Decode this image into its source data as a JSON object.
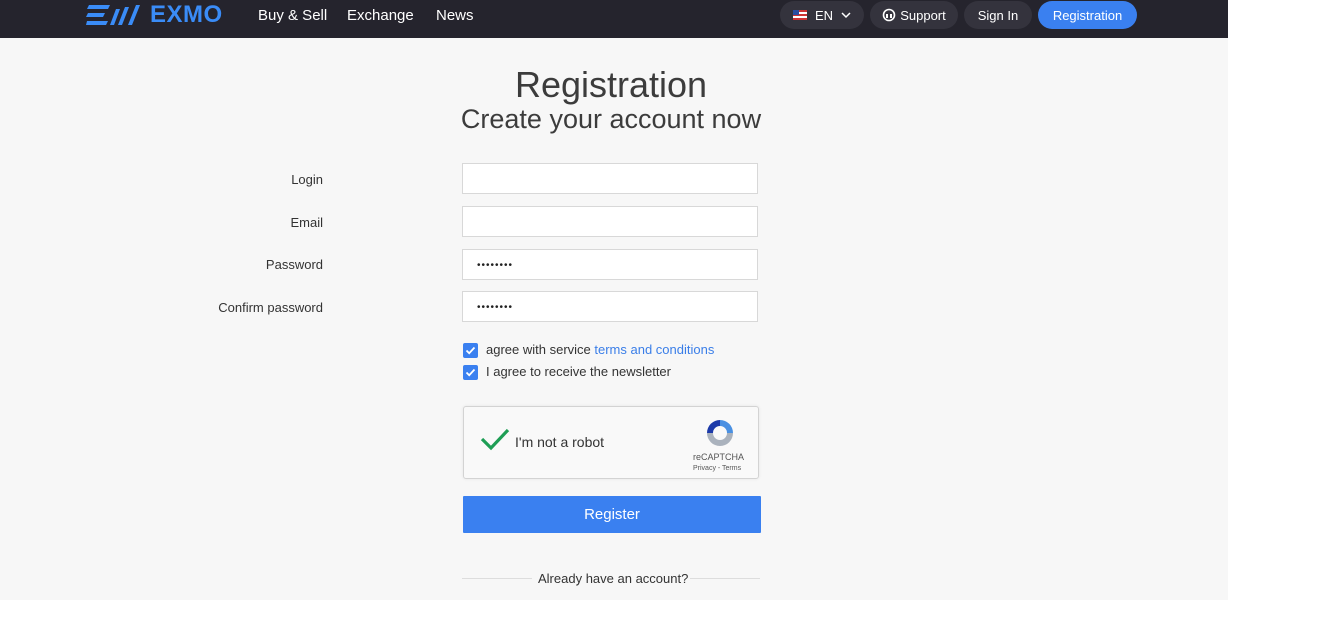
{
  "brand": {
    "name": "EXMO",
    "accent": "#3a80f0"
  },
  "nav": {
    "links": [
      "Buy & Sell",
      "Exchange",
      "News"
    ],
    "language": "EN",
    "support": "Support",
    "sign_in": "Sign In",
    "registration": "Registration"
  },
  "page": {
    "title": "Registration",
    "subtitle": "Create your account now"
  },
  "form": {
    "login_label": "Login",
    "login_value": "",
    "email_label": "Email",
    "email_value": "",
    "password_label": "Password",
    "password_value": "••••••••",
    "confirm_label": "Confirm password",
    "confirm_value": "••••••••",
    "agree_text": "agree with service ",
    "agree_link": "terms and conditions",
    "agree_checked": true,
    "newsletter_text": "I agree to receive the newsletter",
    "newsletter_checked": true
  },
  "captcha": {
    "label": "I'm not a robot",
    "brand": "reCAPTCHA",
    "links": "Privacy - Terms",
    "checked": true
  },
  "register_button": "Register",
  "have_account": "Already have an account?"
}
